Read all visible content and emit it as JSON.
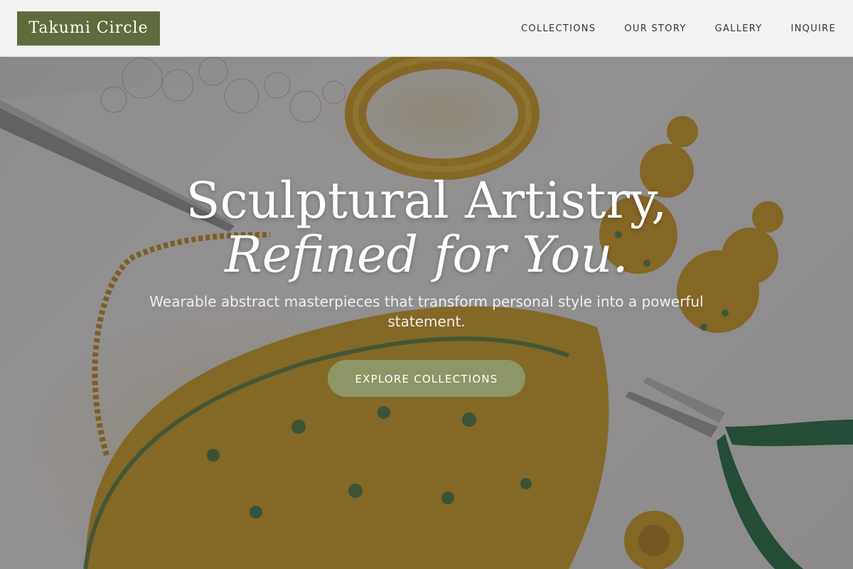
{
  "brand": {
    "name": "Takumi Circle",
    "logo_color": "#5f6b3c"
  },
  "nav": {
    "items": [
      {
        "label": "COLLECTIONS"
      },
      {
        "label": "OUR STORY"
      },
      {
        "label": "GALLERY"
      },
      {
        "label": "INQUIRE"
      }
    ]
  },
  "hero": {
    "headline_line1": "Sculptural Artistry,",
    "headline_line2": "Refined for You.",
    "subtitle": "Wearable abstract masterpieces that transform personal style into a powerful statement.",
    "cta_label": "EXPLORE COLLECTIONS",
    "cta_color": "#8c9667",
    "background_image": "gold-and-emerald-jewelry-workbench-photo"
  }
}
